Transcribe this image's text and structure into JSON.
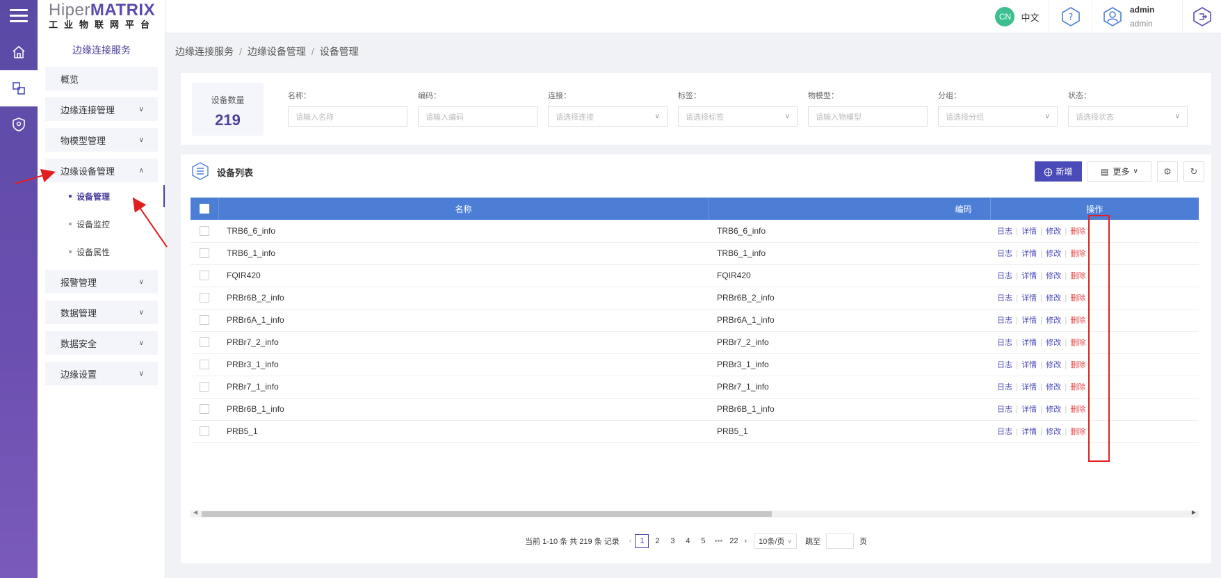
{
  "brand": {
    "name_prefix": "Hiper",
    "name_suffix": "MATRIX",
    "subtitle": "工业物联网平台"
  },
  "sidebar": {
    "title": "边缘连接服务",
    "items": [
      {
        "label": "概览"
      },
      {
        "label": "边缘连接管理"
      },
      {
        "label": "物模型管理"
      },
      {
        "label": "边缘设备管理"
      },
      {
        "label": "报警管理"
      },
      {
        "label": "数据管理"
      },
      {
        "label": "数据安全"
      },
      {
        "label": "边缘设置"
      }
    ],
    "sub_items": [
      {
        "label": "设备管理"
      },
      {
        "label": "设备监控"
      },
      {
        "label": "设备属性"
      }
    ]
  },
  "topbar": {
    "lang_badge": "CN",
    "lang_label": "中文",
    "user_name": "admin",
    "user_role": "admin"
  },
  "breadcrumb": [
    "边缘连接服务",
    "边缘设备管理",
    "设备管理"
  ],
  "filter": {
    "count_label": "设备数量",
    "count_value": "219",
    "fields": [
      {
        "label": "名称：",
        "placeholder": "请输入名称"
      },
      {
        "label": "编码：",
        "placeholder": "请输入编码"
      },
      {
        "label": "连接：",
        "placeholder": "请选择连接"
      },
      {
        "label": "标签：",
        "placeholder": "请选择标签"
      },
      {
        "label": "物模型：",
        "placeholder": "请输入物模型"
      },
      {
        "label": "分组：",
        "placeholder": "请选择分组"
      },
      {
        "label": "状态：",
        "placeholder": "请选择状态"
      }
    ]
  },
  "table": {
    "title": "设备列表",
    "add_label": "新增",
    "more_label": "更多",
    "columns": [
      "名称",
      "编码",
      "操作"
    ],
    "actions": [
      "日志",
      "详情",
      "修改",
      "删除"
    ],
    "rows": [
      {
        "name": "TRB6_6_info",
        "code": "TRB6_6_info"
      },
      {
        "name": "TRB6_1_info",
        "code": "TRB6_1_info"
      },
      {
        "name": "FQIR420",
        "code": "FQIR420"
      },
      {
        "name": "PRBr6B_2_info",
        "code": "PRBr6B_2_info"
      },
      {
        "name": "PRBr6A_1_info",
        "code": "PRBr6A_1_info"
      },
      {
        "name": "PRBr7_2_info",
        "code": "PRBr7_2_info"
      },
      {
        "name": "PRBr3_1_info",
        "code": "PRBr3_1_info"
      },
      {
        "name": "PRBr7_1_info",
        "code": "PRBr7_1_info"
      },
      {
        "name": "PRBr6B_1_info",
        "code": "PRBr6B_1_info"
      },
      {
        "name": "PRB5_1",
        "code": "PRB5_1"
      }
    ]
  },
  "pagination": {
    "summary": "当前 1-10 条 共 219 条 记录",
    "pages": [
      "1",
      "2",
      "3",
      "4",
      "5",
      "•••",
      "22"
    ],
    "current": "1",
    "page_size": "10条/页",
    "jump_label": "跳至",
    "page_unit": "页"
  },
  "colors": {
    "primary": "#4a4ab8",
    "header": "#4c7ed6",
    "rail": "#5a4aa6",
    "danger": "#e24a4a",
    "annotation": "#e02020"
  }
}
